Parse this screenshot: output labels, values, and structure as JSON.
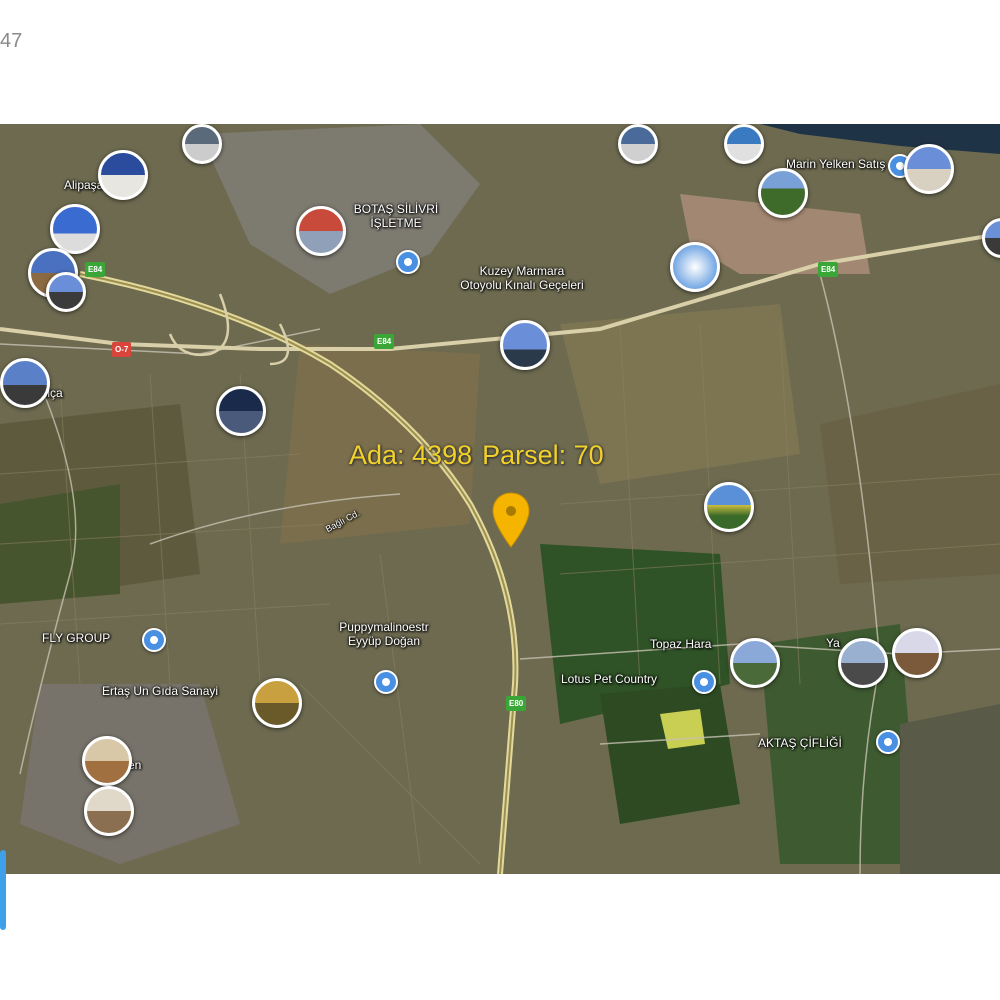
{
  "corner_text": "47",
  "parcel": {
    "ada_label": "Ada: 4398",
    "parsel_label": "Parsel: 70"
  },
  "places": {
    "alipasa": "Alipaşa",
    "botas": "BOTAŞ SİLİVRİ\nİŞLETME",
    "kuzey_marmara": "Kuzey Marmara\nOtoyolu Kınalı Geçeleri",
    "marina": "Marin Yelken Satış",
    "kaliga": "Kaliça",
    "fly_group": "FLY GROUP",
    "ertas": "Ertaş Un Gıda Sanayi",
    "puppy": "Puppymalinoestr\nEyyüp Doğan",
    "topaz": "Topaz Hara",
    "lotus": "Lotus Pet Country",
    "aktas": "AKTAŞ ÇİFLİĞİ",
    "men": "men",
    "bagli_cd": "Bağlı Cd.",
    "ya": "Ya"
  },
  "road_shields": {
    "e84_a": "E84",
    "e84_b": "E84",
    "e84_c": "E84",
    "e80": "E80",
    "o7": "O-7"
  },
  "colors": {
    "parcel_label": "#f2d22a",
    "pin": "#f4b400",
    "poi": "#4a90e2",
    "highway_shield": "#3aa637",
    "toll_shield": "#d9443b"
  },
  "icons": [
    "location-pin-icon",
    "poi-marker-icon",
    "photo-thumbnail-icon"
  ]
}
